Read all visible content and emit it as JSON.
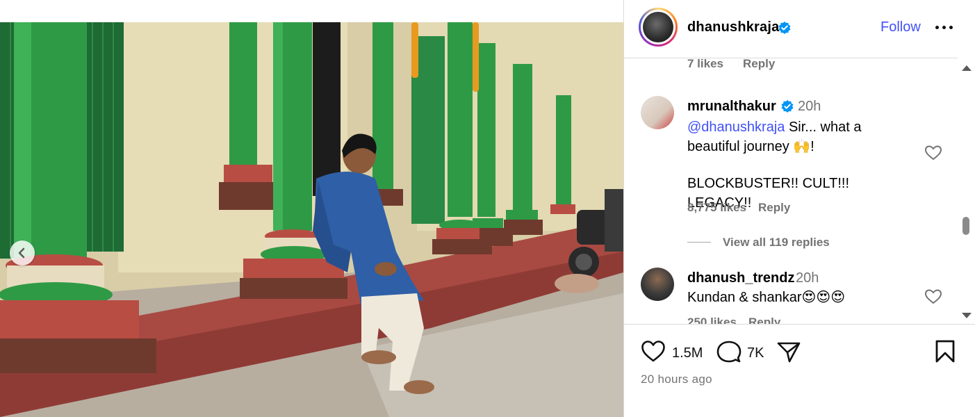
{
  "post": {
    "author": "dhanushkraja",
    "follow_label": "Follow",
    "likes_count": "1.5M",
    "comments_count": "7K",
    "time_ago": "20 hours ago"
  },
  "comments": {
    "previous_meta": {
      "likes": "7 likes",
      "reply": "Reply"
    },
    "items": [
      {
        "username": "mrunalthakur",
        "time": "20h",
        "mention": "@dhanushkraja",
        "text_line1": " Sir... what a",
        "text_line2": "beautiful journey 🙌!",
        "text_line3": "BLOCKBUSTER!! CULT!!! LEGACY!!",
        "likes": "8,775 likes",
        "reply": "Reply",
        "view_replies": "View all 119 replies"
      },
      {
        "username": "dhanush_trendz",
        "time": "20h",
        "text": "Kundan & shankar😍😍😍",
        "likes": "250 likes",
        "reply": "Reply"
      }
    ]
  },
  "colors": {
    "accent_blue": "#4150f7",
    "verified_blue": "#0095f6",
    "pillar_green": "#2f9a45",
    "plinth_red": "#a84a42"
  },
  "icons": {
    "carousel_prev": "chevron-left-icon",
    "like": "heart-icon",
    "comment": "comment-bubble-icon",
    "share": "paper-plane-icon",
    "save": "bookmark-icon",
    "more": "ellipsis-icon"
  }
}
